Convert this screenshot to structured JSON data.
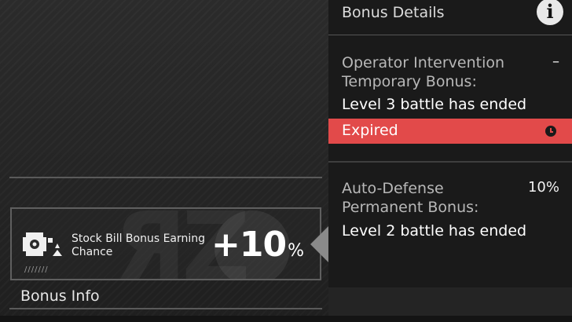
{
  "left": {
    "card": {
      "label": "Stock Bill Bonus Earning Chance",
      "value": "+10",
      "unit": "%",
      "ticks": "///////"
    },
    "bonus_info_title": "Bonus Info"
  },
  "panel": {
    "title": "Bonus Details",
    "info_icon": "i",
    "sections": [
      {
        "title_line1": "Operator Intervention",
        "title_line2": "Temporary Bonus:",
        "value": "–",
        "detail": "Level 3 battle has ended",
        "status": "Expired"
      },
      {
        "title_line1": "Auto-Defense",
        "title_line2": "Permanent Bonus:",
        "value": "10%",
        "detail": "Level 2 battle has ended"
      }
    ]
  },
  "colors": {
    "expired": "#e24a4a",
    "panel_bg": "#1a1a1a",
    "background": "#262626"
  }
}
